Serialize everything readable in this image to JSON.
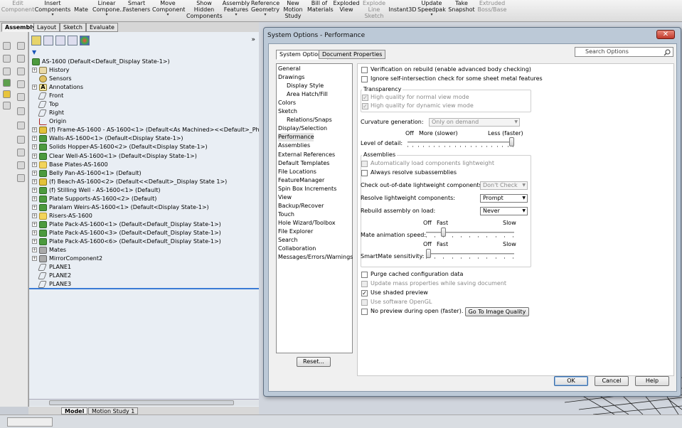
{
  "ribbon": {
    "items": [
      {
        "label": "Edit\nComponent",
        "disabled": true
      },
      {
        "label": "Insert\nComponents",
        "caret": true
      },
      {
        "label": "Mate"
      },
      {
        "label": "Linear\nCompone...",
        "caret": true
      },
      {
        "label": "Smart\nFasteners"
      },
      {
        "label": "Move\nComponent",
        "caret": true
      },
      {
        "label": "Show\nHidden\nComponents"
      },
      {
        "label": "Assembly\nFeatures",
        "caret": true
      },
      {
        "label": "Reference\nGeometry",
        "caret": true
      },
      {
        "label": "New\nMotion\nStudy"
      },
      {
        "label": "Bill of\nMaterials"
      },
      {
        "label": "Exploded\nView"
      },
      {
        "label": "Explode\nLine\nSketch",
        "disabled": true
      },
      {
        "label": "Instant3D"
      },
      {
        "label": "Update\nSpeedpak",
        "caret": true
      },
      {
        "label": "Take\nSnapshot"
      },
      {
        "label": "Extruded\nBoss/Base",
        "disabled": true
      }
    ]
  },
  "command_tabs": [
    "Assembly",
    "Layout",
    "Sketch",
    "Evaluate"
  ],
  "feature_tree": {
    "root": "AS-1600  (Default<Default_Display State-1>)",
    "items": [
      {
        "label": "History",
        "icon": "history",
        "expand": true
      },
      {
        "label": "Sensors",
        "icon": "sensor",
        "expand": false
      },
      {
        "label": "Annotations",
        "icon": "annotation",
        "expand": true
      },
      {
        "label": "Front",
        "icon": "plane",
        "expand": false
      },
      {
        "label": "Top",
        "icon": "plane",
        "expand": false
      },
      {
        "label": "Right",
        "icon": "plane",
        "expand": false
      },
      {
        "label": "Origin",
        "icon": "origin",
        "expand": false
      },
      {
        "label": "(f) Frame-AS-1600 - AS-1600<1> (Default<As Machined><<Default>_PhotoWorks D",
        "icon": "part",
        "expand": true
      },
      {
        "label": "Walls-AS-1600<1> (Default<Display State-1>)",
        "icon": "assembly",
        "expand": true
      },
      {
        "label": "Solids Hopper-AS-1600<2> (Default<Display State-1>)",
        "icon": "assembly",
        "expand": true
      },
      {
        "label": "Clear Well-AS-1600<1> (Default<Display State-1>)",
        "icon": "assembly",
        "expand": true
      },
      {
        "label": "Base Plates-AS-1600",
        "icon": "folder",
        "expand": true
      },
      {
        "label": "Belly Pan-AS-1600<1> (Default)",
        "icon": "assembly",
        "expand": true
      },
      {
        "label": "(f) Beach-AS-1600<2> (Default<<Default>_Display State 1>)",
        "icon": "part",
        "expand": true
      },
      {
        "label": "(f) Stilling Well - AS-1600<1> (Default)",
        "icon": "assembly",
        "expand": true
      },
      {
        "label": "Plate Supports-AS-1600<2> (Default)",
        "icon": "assembly",
        "expand": true
      },
      {
        "label": "Paralam Weirs-AS-1600<1> (Default<Display State-1>)",
        "icon": "assembly",
        "expand": true
      },
      {
        "label": "Risers-AS-1600",
        "icon": "folder",
        "expand": true
      },
      {
        "label": "Plate Pack-AS-1600<1> (Default<Default_Display State-1>)",
        "icon": "assembly",
        "expand": true
      },
      {
        "label": "Plate Pack-AS-1600<3> (Default<Default_Display State-1>)",
        "icon": "assembly",
        "expand": true
      },
      {
        "label": "Plate Pack-AS-1600<6> (Default<Default_Display State-1>)",
        "icon": "assembly",
        "expand": true
      },
      {
        "label": "Mates",
        "icon": "mate",
        "expand": true
      },
      {
        "label": "MirrorComponent2",
        "icon": "mirror",
        "expand": true
      },
      {
        "label": "PLANE1",
        "icon": "plane",
        "expand": false
      },
      {
        "label": "PLANE2",
        "icon": "plane",
        "expand": false
      },
      {
        "label": "PLANE3",
        "icon": "plane",
        "expand": false
      }
    ]
  },
  "bottom_tabs": [
    "Model",
    "Motion Study 1"
  ],
  "dialog": {
    "title": "System Options - Performance",
    "close": "✕",
    "tabs": [
      "System Options",
      "Document Properties"
    ],
    "search_placeholder": "Search Options",
    "nav": [
      {
        "label": "General",
        "indent": 0
      },
      {
        "label": "Drawings",
        "indent": 0
      },
      {
        "label": "Display Style",
        "indent": 1
      },
      {
        "label": "Area Hatch/Fill",
        "indent": 1
      },
      {
        "label": "Colors",
        "indent": 0
      },
      {
        "label": "Sketch",
        "indent": 0
      },
      {
        "label": "Relations/Snaps",
        "indent": 1
      },
      {
        "label": "Display/Selection",
        "indent": 0
      },
      {
        "label": "Performance",
        "indent": 0,
        "selected": true
      },
      {
        "label": "Assemblies",
        "indent": 0
      },
      {
        "label": "External References",
        "indent": 0
      },
      {
        "label": "Default Templates",
        "indent": 0
      },
      {
        "label": "File Locations",
        "indent": 0
      },
      {
        "label": "FeatureManager",
        "indent": 0
      },
      {
        "label": "Spin Box Increments",
        "indent": 0
      },
      {
        "label": "View",
        "indent": 0
      },
      {
        "label": "Backup/Recover",
        "indent": 0
      },
      {
        "label": "Touch",
        "indent": 0
      },
      {
        "label": "Hole Wizard/Toolbox",
        "indent": 0
      },
      {
        "label": "File Explorer",
        "indent": 0
      },
      {
        "label": "Search",
        "indent": 0
      },
      {
        "label": "Collaboration",
        "indent": 0
      },
      {
        "label": "Messages/Errors/Warnings",
        "indent": 0
      }
    ],
    "reset": "Reset...",
    "verification": "Verification on rebuild (enable advanced body checking)",
    "ignore_self": "Ignore self-intersection check for some sheet metal features",
    "transparency": {
      "title": "Transparency",
      "normal": "High quality for normal view mode",
      "dynamic": "High quality for dynamic view mode"
    },
    "curvature": {
      "label": "Curvature generation:",
      "value": "Only on demand"
    },
    "lod": {
      "label": "Level of detail:",
      "off": "Off",
      "more": "More (slower)",
      "less": "Less (faster)",
      "level": 1.0
    },
    "assemblies": {
      "title": "Assemblies",
      "auto_load": "Automatically load components lightweight",
      "always_resolve": "Always resolve subassemblies",
      "check_ood": {
        "label": "Check out-of-date lightweight components:",
        "value": "Don't Check"
      },
      "resolve_lw": {
        "label": "Resolve lightweight components:",
        "value": "Prompt"
      },
      "rebuild": {
        "label": "Rebuild assembly on load:",
        "value": "Never"
      },
      "mate_anim": {
        "label": "Mate animation speed:",
        "off": "Off",
        "fast": "Fast",
        "slow": "Slow",
        "level": 0.18
      },
      "smartmate": {
        "label": "SmartMate sensitivity:",
        "off": "Off",
        "fast": "Fast",
        "slow": "Slow",
        "level": 0.0
      }
    },
    "purge": "Purge cached configuration data",
    "update_mass": "Update mass properties while saving document",
    "shaded_preview": "Use shaded preview",
    "opengl": "Use software OpenGL",
    "no_preview": "No preview during open (faster).",
    "go_iq": "Go To Image Quality",
    "ok": "OK",
    "cancel": "Cancel",
    "help": "Help"
  },
  "colors": {
    "accent": "#3a7bd5",
    "tree_bg": "#e9eef4",
    "dialog_frame": "#bcc9d7"
  }
}
